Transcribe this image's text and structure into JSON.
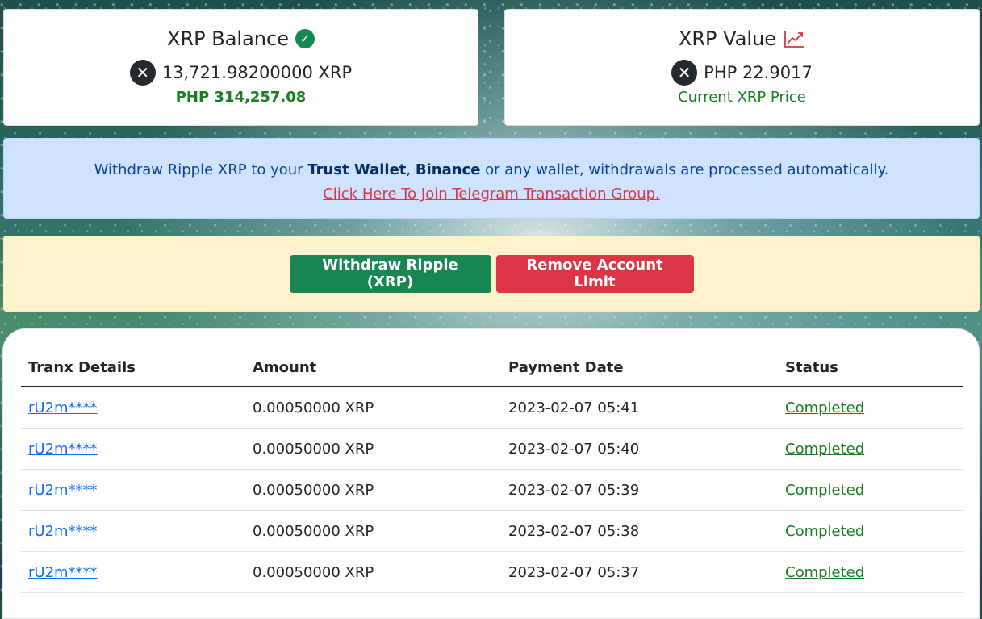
{
  "balance_card": {
    "title": "XRP Balance",
    "amount": "13,721.98200000 XRP",
    "php_value": "PHP 314,257.08"
  },
  "value_card": {
    "title": "XRP Value",
    "price": "PHP 22.9017",
    "subtitle": "Current XRP Price"
  },
  "info_alert": {
    "text_before": "Withdraw Ripple XRP to your ",
    "trust_wallet": "Trust Wallet",
    "comma": ", ",
    "binance": "Binance",
    "text_after": " or any wallet, withdrawals are processed automatically.",
    "telegram_link": "Click Here To Join Telegram Transaction Group."
  },
  "actions": {
    "withdraw_label": "Withdraw Ripple (XRP)",
    "remove_limit_label": "Remove Account Limit"
  },
  "table": {
    "headers": [
      "Tranx Details",
      "Amount",
      "Payment Date",
      "Status"
    ],
    "rows": [
      {
        "tranx": "rU2m****",
        "amount": "0.00050000 XRP",
        "date": "2023-02-07 05:41",
        "status": "Completed"
      },
      {
        "tranx": "rU2m****",
        "amount": "0.00050000 XRP",
        "date": "2023-02-07 05:40",
        "status": "Completed"
      },
      {
        "tranx": "rU2m****",
        "amount": "0.00050000 XRP",
        "date": "2023-02-07 05:39",
        "status": "Completed"
      },
      {
        "tranx": "rU2m****",
        "amount": "0.00050000 XRP",
        "date": "2023-02-07 05:38",
        "status": "Completed"
      },
      {
        "tranx": "rU2m****",
        "amount": "0.00050000 XRP",
        "date": "2023-02-07 05:37",
        "status": "Completed"
      }
    ]
  },
  "icons": {
    "xrp_logo": "xrp-logo-icon",
    "check": "check-circle-icon",
    "trend": "trend-up-icon"
  },
  "colors": {
    "success": "#198754",
    "danger": "#dc3545",
    "info_bg": "#cfe2ff",
    "warning_bg": "#fff3cd",
    "link": "#0d6efd"
  }
}
